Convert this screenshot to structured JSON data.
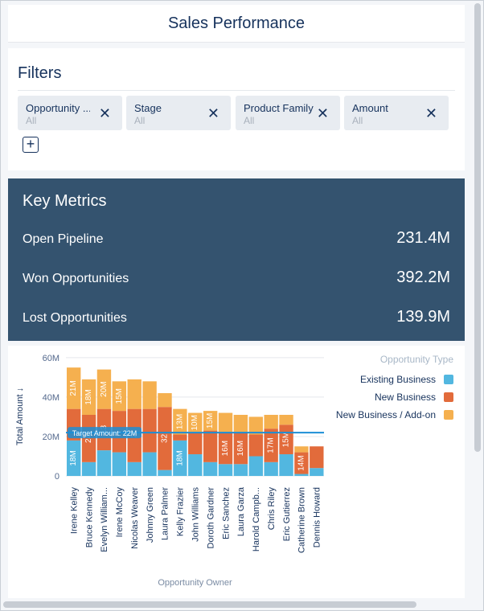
{
  "header": {
    "title": "Sales Performance"
  },
  "filters": {
    "title": "Filters",
    "chips": [
      {
        "label": "Opportunity ...",
        "value": "All"
      },
      {
        "label": "Stage",
        "value": "All"
      },
      {
        "label": "Product Family",
        "value": "All"
      },
      {
        "label": "Amount",
        "value": "All"
      }
    ],
    "add_label": "+"
  },
  "key_metrics": {
    "title": "Key Metrics",
    "rows": [
      {
        "label": "Open Pipeline",
        "value": "231.4M"
      },
      {
        "label": "Won Opportunities",
        "value": "392.2M"
      },
      {
        "label": "Lost Opportunities",
        "value": "139.9M"
      }
    ]
  },
  "colors": {
    "existing": "#52b7e0",
    "new": "#e26b3b",
    "addon": "#f5b04f",
    "ref_line": "#1b8ed6",
    "metrics_bg": "#34536f"
  },
  "chart_data": {
    "type": "bar",
    "stacked": true,
    "title": "",
    "xlabel": "Opportunity Owner",
    "ylabel": "Total Amount ↓",
    "y_ticks": [
      "60M",
      "40M",
      "20M",
      "0"
    ],
    "ylim": [
      0,
      62
    ],
    "legend": {
      "title": "Opportunity Type",
      "position": "right"
    },
    "categories": [
      "Irene Kelley",
      "Bruce Kennedy",
      "Evelyn William...",
      "Irene McCoy",
      "Nicolas Weaver",
      "Johnny Green",
      "Laura Palmer",
      "Kelly Frazier",
      "John Williams",
      "Doroth Gardner",
      "Eric Sanchez",
      "Laura Garza",
      "Harold Campb...",
      "Chris Riley",
      "Eric Gutierrez",
      "Catherine Brown",
      "Dennis Howard"
    ],
    "series": [
      {
        "name": "Existing Business",
        "values": [
          18,
          7,
          13,
          12,
          7,
          12,
          3,
          18,
          11,
          7,
          6,
          6,
          10,
          7,
          11,
          1,
          4
        ]
      },
      {
        "name": "New Business",
        "values": [
          16,
          24,
          21,
          21,
          27,
          22,
          32,
          3,
          11,
          16,
          16,
          16,
          11,
          17,
          15,
          11,
          11
        ]
      },
      {
        "name": "New Business / Add-on",
        "values": [
          21,
          18,
          20,
          15,
          15,
          14,
          7,
          13,
          10,
          10,
          10,
          9,
          9,
          7,
          5,
          3,
          0
        ]
      }
    ],
    "bar_labels": [
      [
        "18M",
        "",
        "21M"
      ],
      [
        "",
        "24",
        "18M"
      ],
      [
        "",
        "13",
        "20M"
      ],
      [
        "",
        "",
        "15M"
      ],
      [
        "",
        "2",
        ""
      ],
      [
        "",
        "",
        ""
      ],
      [
        "",
        "32",
        ""
      ],
      [
        "18M",
        "",
        "13M"
      ],
      [
        "",
        "",
        "10M"
      ],
      [
        "",
        "",
        "15M"
      ],
      [
        "",
        "16M",
        ""
      ],
      [
        "",
        "16M",
        ""
      ],
      [
        "",
        "",
        ""
      ],
      [
        "",
        "17M",
        ""
      ],
      [
        "",
        "15M",
        ""
      ],
      [
        "",
        "14M",
        ""
      ],
      [
        "",
        "",
        ""
      ]
    ],
    "reference_line": {
      "value": 22,
      "label": "Target Amount: 22M"
    }
  }
}
